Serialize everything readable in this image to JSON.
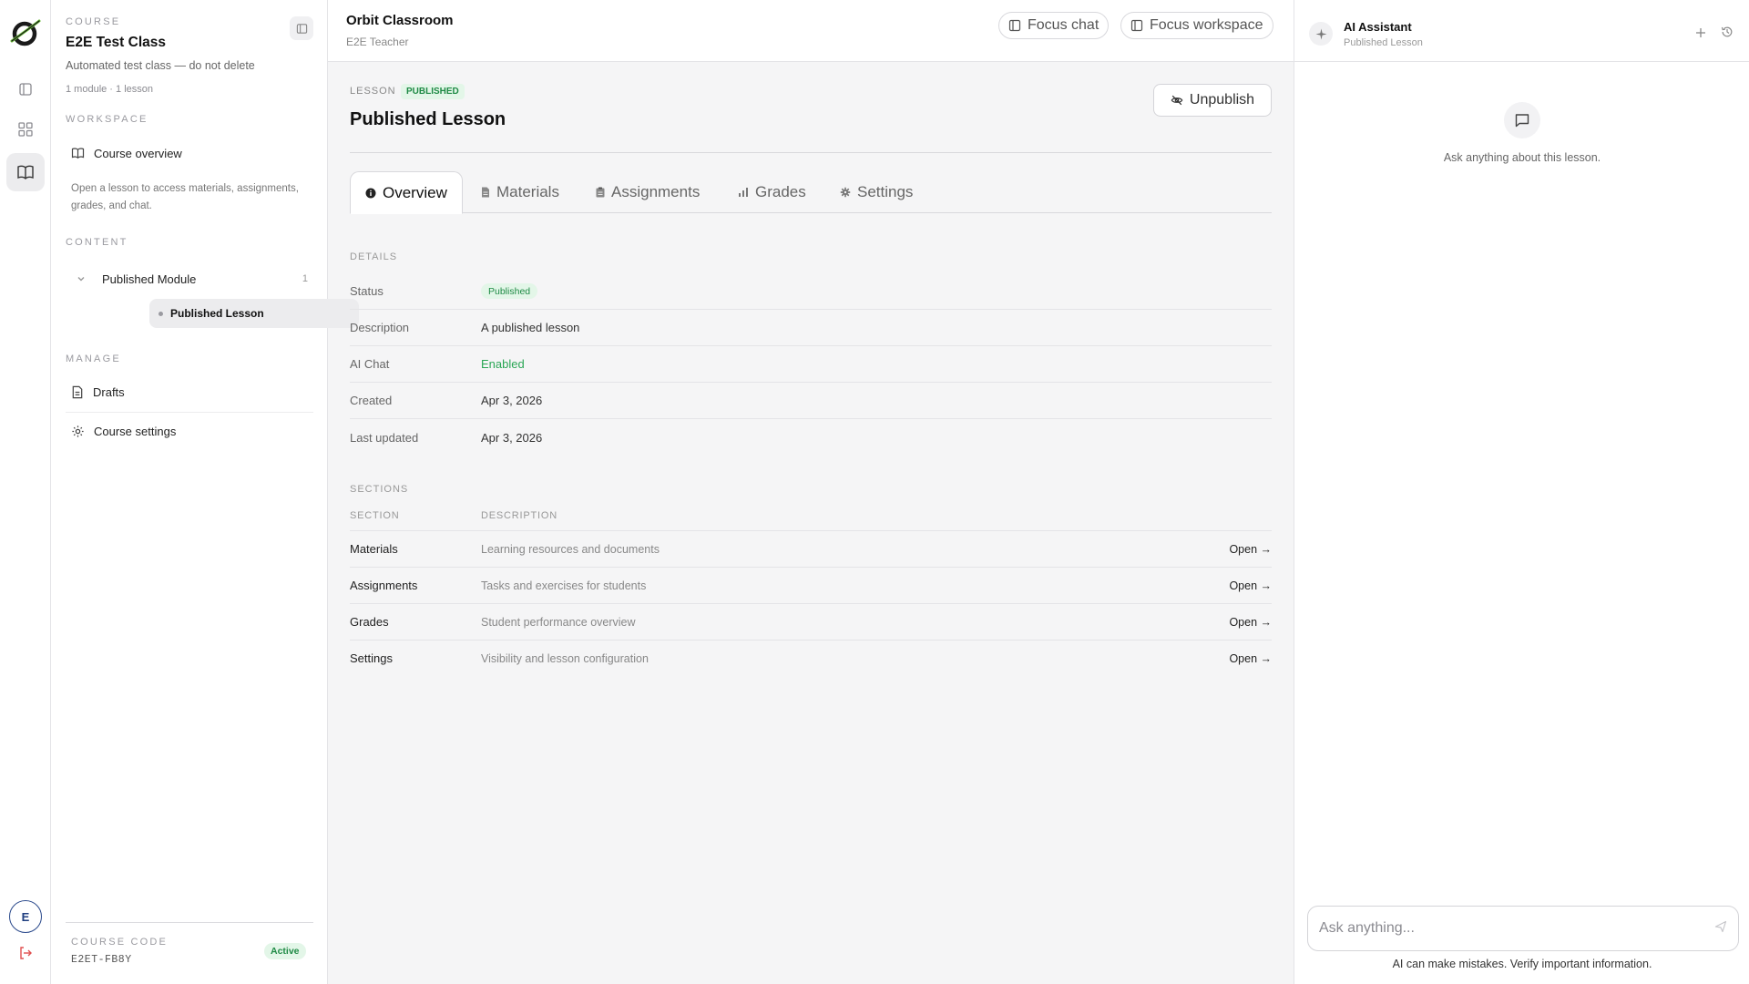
{
  "sidebar": {
    "course_label": "COURSE",
    "course_title": "E2E Test Class",
    "course_desc": "Automated test class — do not delete",
    "course_meta": "1 module · 1 lesson",
    "workspace_label": "WORKSPACE",
    "course_overview": "Course overview",
    "help_text": "Open a lesson to access materials, assignments, grades, and chat.",
    "content_label": "CONTENT",
    "module_name": "Published Module",
    "module_count": "1",
    "lesson_name": "Published Lesson",
    "manage_label": "MANAGE",
    "drafts": "Drafts",
    "course_settings": "Course settings",
    "course_code_label": "COURSE CODE",
    "course_code": "E2ET-FB8Y",
    "active_badge": "Active"
  },
  "rail": {
    "avatar_initial": "E"
  },
  "header": {
    "title": "Orbit Classroom",
    "subtitle": "E2E Teacher",
    "focus_chat": "Focus chat",
    "focus_workspace": "Focus workspace"
  },
  "lesson": {
    "label": "LESSON",
    "badge": "PUBLISHED",
    "title": "Published Lesson",
    "unpublish": "Unpublish"
  },
  "tabs": [
    {
      "label": "Overview",
      "icon": "info-icon"
    },
    {
      "label": "Materials",
      "icon": "file-icon"
    },
    {
      "label": "Assignments",
      "icon": "clipboard-icon"
    },
    {
      "label": "Grades",
      "icon": "bar-chart-icon"
    },
    {
      "label": "Settings",
      "icon": "gear-icon"
    }
  ],
  "details": {
    "label": "DETAILS",
    "rows": [
      {
        "key": "Status",
        "value": "Published"
      },
      {
        "key": "Description",
        "value": "A published lesson"
      },
      {
        "key": "AI Chat",
        "value": "Enabled"
      },
      {
        "key": "Created",
        "value": "Apr 3, 2026"
      },
      {
        "key": "Last updated",
        "value": "Apr 3, 2026"
      }
    ]
  },
  "sections": {
    "label": "SECTIONS",
    "col_section": "SECTION",
    "col_description": "DESCRIPTION",
    "rows": [
      {
        "name": "Materials",
        "desc": "Learning resources and documents",
        "action": "Open →"
      },
      {
        "name": "Assignments",
        "desc": "Tasks and exercises for students",
        "action": "Open →"
      },
      {
        "name": "Grades",
        "desc": "Student performance overview",
        "action": "Open →"
      },
      {
        "name": "Settings",
        "desc": "Visibility and lesson configuration",
        "action": "Open →"
      }
    ]
  },
  "ai": {
    "title": "AI Assistant",
    "subtitle": "Published Lesson",
    "empty_text": "Ask anything about this lesson.",
    "input_placeholder": "Ask anything...",
    "disclaimer": "AI can make mistakes. Verify important information."
  },
  "colors": {
    "accent_green": "#2aa655",
    "badge_green_bg": "#e3f6e8",
    "logout_red": "#e05050"
  }
}
